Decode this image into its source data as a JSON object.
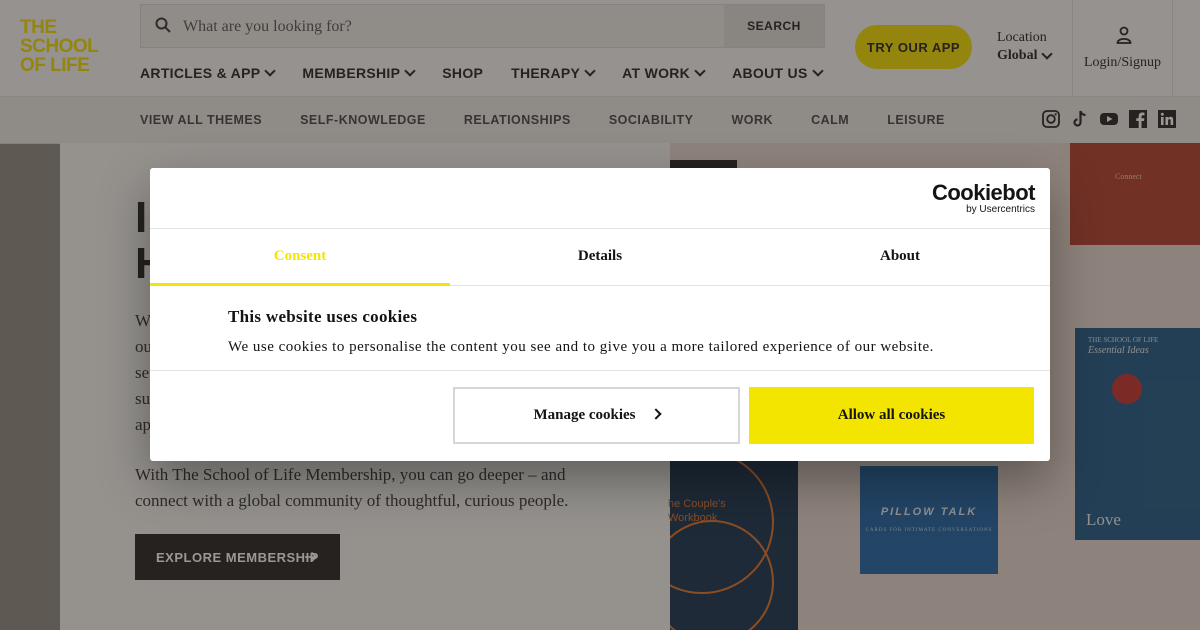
{
  "header": {
    "logo_lines": [
      "THE",
      "SCHOOL",
      "OF LIFE"
    ],
    "search": {
      "placeholder": "What are you looking for?",
      "button": "SEARCH"
    },
    "nav": [
      {
        "label": "ARTICLES & APP",
        "has_menu": true
      },
      {
        "label": "MEMBERSHIP",
        "has_menu": true
      },
      {
        "label": "SHOP",
        "has_menu": false
      },
      {
        "label": "THERAPY",
        "has_menu": true
      },
      {
        "label": "AT WORK",
        "has_menu": true
      },
      {
        "label": "ABOUT US",
        "has_menu": true
      }
    ],
    "try_app": "TRY OUR APP",
    "location": {
      "label": "Location",
      "value": "Global"
    },
    "login": "Login/Signup"
  },
  "themes": [
    "VIEW ALL THEMES",
    "SELF-KNOWLEDGE",
    "RELATIONSHIPS",
    "SOCIABILITY",
    "WORK",
    "CALM",
    "LEISURE"
  ],
  "socials": [
    "instagram-icon",
    "tiktok-icon",
    "youtube-icon",
    "facebook-icon",
    "linkedin-icon"
  ],
  "hero": {
    "heading_lines": [
      "I",
      "H"
    ],
    "para_lines": [
      "W",
      "ou",
      "se",
      "su",
      "ap"
    ],
    "para2": "With The School of Life Membership, you can go deeper – and connect with a global community of thoughtful, curious people.",
    "cta": "EXPLORE MEMBERSHIP",
    "books": {
      "red_title": "Connect",
      "blue_publisher": "THE SCHOOL OF LIFE",
      "blue_series": "Essential Ideas",
      "blue_title": "Love",
      "couple_title": "he Couple's Workbook",
      "pillow_title": "PILLOW TALK",
      "pillow_sub": "CARDS FOR INTIMATE CONVERSATIONS"
    }
  },
  "cookie": {
    "brand": "Cookiebot",
    "brand_sub": "by Usercentrics",
    "tabs": [
      {
        "label": "Consent",
        "active": true
      },
      {
        "label": "Details",
        "active": false
      },
      {
        "label": "About",
        "active": false
      }
    ],
    "title": "This website uses cookies",
    "text": "We use cookies to personalise the content you see and to give you a more tailored experience of our website.",
    "manage_button": "Manage cookies",
    "allow_button": "Allow all cookies"
  },
  "colors": {
    "brand_yellow": "#f2dd00",
    "consent_yellow": "#f4e500",
    "dark": "#222222"
  }
}
